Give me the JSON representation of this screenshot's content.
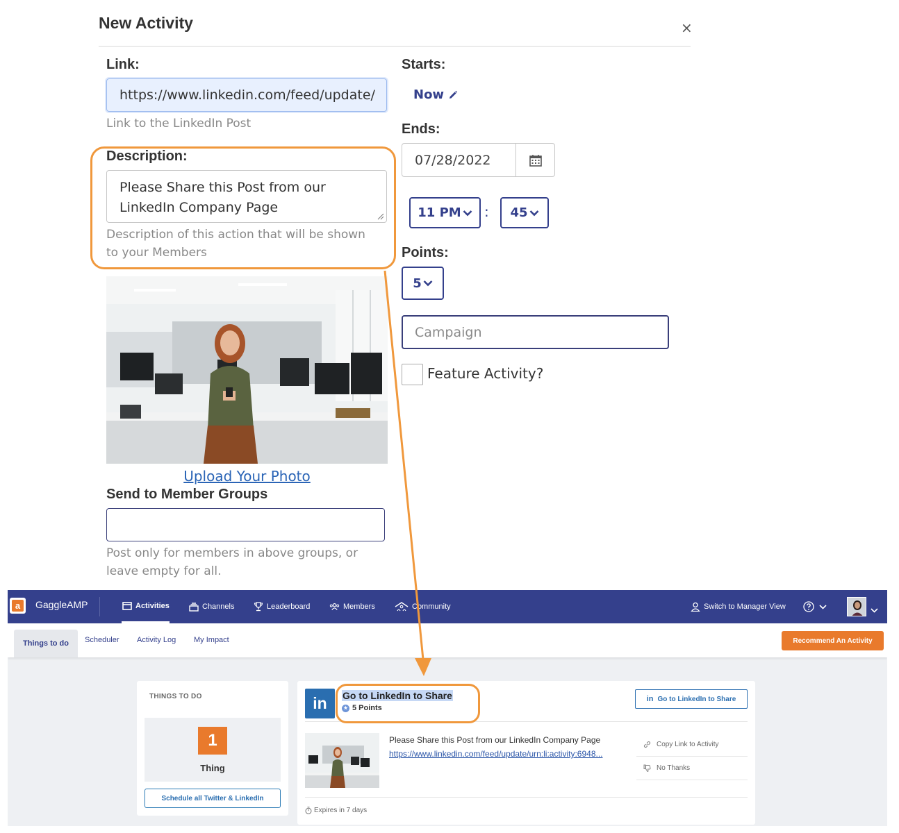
{
  "modal": {
    "title": "New Activity",
    "close_symbol": "×",
    "link": {
      "label": "Link:",
      "value": "https://www.linkedin.com/feed/update/",
      "help": "Link to the LinkedIn Post"
    },
    "description": {
      "label": "Description:",
      "value": "Please Share this Post from our LinkedIn Company Page",
      "help": "Description of this action that will be shown to your Members"
    },
    "photo": {
      "upload_label": "Upload Your Photo"
    },
    "member_groups": {
      "label": "Send to Member Groups",
      "value": "",
      "help": "Post only for members in above groups, or leave empty for all."
    },
    "starts": {
      "label": "Starts:",
      "value": "Now"
    },
    "ends": {
      "label": "Ends:",
      "date": "07/28/2022",
      "hour": "11 PM",
      "separator": ":",
      "minute": "45"
    },
    "points": {
      "label": "Points:",
      "value": "5"
    },
    "campaign": {
      "placeholder": "Campaign"
    },
    "feature": {
      "label": "Feature Activity?",
      "checked": false
    }
  },
  "app": {
    "brand": "GaggleAMP",
    "nav": [
      {
        "label": "Activities",
        "icon": "inbox-icon",
        "active": true
      },
      {
        "label": "Channels",
        "icon": "stack-icon",
        "active": false
      },
      {
        "label": "Leaderboard",
        "icon": "trophy-icon",
        "active": false
      },
      {
        "label": "Members",
        "icon": "people-icon",
        "active": false
      },
      {
        "label": "Community",
        "icon": "community-icon",
        "active": false
      }
    ],
    "manager_view": "Switch to Manager View",
    "subtabs": [
      {
        "label": "Things to do",
        "active": true
      },
      {
        "label": "Scheduler",
        "active": false
      },
      {
        "label": "Activity Log",
        "active": false
      },
      {
        "label": "My Impact",
        "active": false
      }
    ],
    "recommend_button": "Recommend An Activity",
    "things_to_do": {
      "title": "THINGS TO DO",
      "count": "1",
      "count_label": "Thing",
      "schedule_button": "Schedule all Twitter & LinkedIn"
    },
    "activity": {
      "title": "Go to LinkedIn to Share",
      "points": "5 Points",
      "button": "Go to LinkedIn to Share",
      "text": "Please Share this Post from our LinkedIn Company Page",
      "link": "https://www.linkedin.com/feed/update/urn:li:activity:6948...",
      "copy_link": "Copy Link to Activity",
      "no_thanks": "No Thanks",
      "expires": "Expires in 7 days"
    }
  },
  "colors": {
    "accent": "#34408c",
    "highlight": "#f0983c",
    "brand_orange": "#e97a2c",
    "linkedin": "#2a6eb0"
  }
}
